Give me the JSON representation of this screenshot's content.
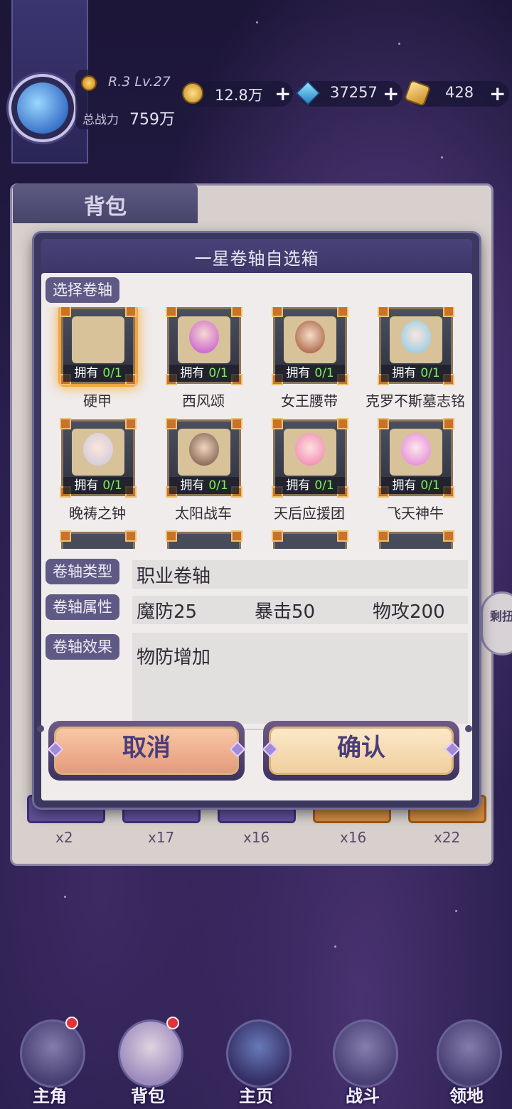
{
  "player": {
    "rank_level": "R.3 Lv.27",
    "power_label": "总战力",
    "power_value": "759万"
  },
  "resources": [
    {
      "icon": "gold-coin-icon",
      "value": "12.8万"
    },
    {
      "icon": "blue-crystal-icon",
      "value": "37257"
    },
    {
      "icon": "gold-ticket-icon",
      "value": "428"
    }
  ],
  "bag": {
    "title": "背包",
    "counts": [
      "x2",
      "x17",
      "x16",
      "x16",
      "x22"
    ]
  },
  "modal": {
    "title": "一星卷轴自选箱",
    "select_label": "选择卷轴",
    "items": [
      {
        "name": "硬甲",
        "owned_label": "拥有",
        "owned_count": "0/1",
        "selected": true
      },
      {
        "name": "西风颂",
        "owned_label": "拥有",
        "owned_count": "0/1"
      },
      {
        "name": "女王腰带",
        "owned_label": "拥有",
        "owned_count": "0/1"
      },
      {
        "name": "克罗不斯墓志铭",
        "owned_label": "拥有",
        "owned_count": "0/1"
      },
      {
        "name": "晚祷之钟",
        "owned_label": "拥有",
        "owned_count": "0/1"
      },
      {
        "name": "太阳战车",
        "owned_label": "拥有",
        "owned_count": "0/1"
      },
      {
        "name": "天后应援团",
        "owned_label": "拥有",
        "owned_count": "0/1"
      },
      {
        "name": "飞天神牛",
        "owned_label": "拥有",
        "owned_count": "0/1"
      }
    ],
    "type_label": "卷轴类型",
    "type_value": "职业卷轴",
    "attr_label": "卷轴属性",
    "attrs": [
      "魔防25",
      "暴击50",
      "物攻200"
    ],
    "effect_label": "卷轴效果",
    "effect_value": "物防增加",
    "cancel_label": "取消",
    "confirm_label": "确认"
  },
  "side_badge": "剩扭",
  "nav": [
    {
      "label": "主角",
      "badge": true
    },
    {
      "label": "背包",
      "badge": true
    },
    {
      "label": "主页",
      "badge": false
    },
    {
      "label": "战斗",
      "badge": false
    },
    {
      "label": "领地",
      "badge": false
    }
  ],
  "colors": {
    "accent_purple": "#5f5a85",
    "owned_green": "#7cf05e",
    "badge_red": "#e0343a",
    "selected_glow": "#f3a43c"
  }
}
